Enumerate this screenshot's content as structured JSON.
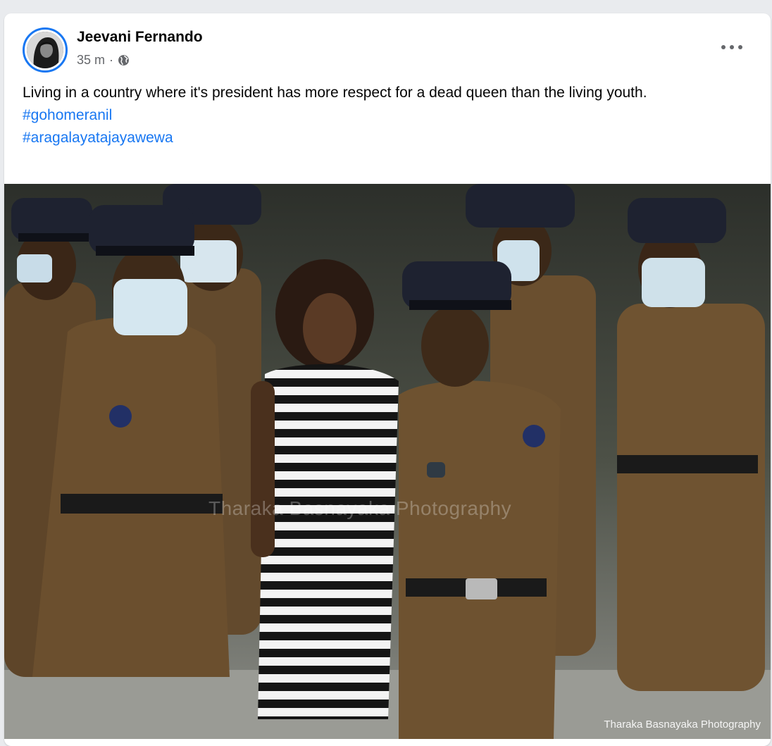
{
  "post": {
    "author": "Jeevani Fernando",
    "time": "35 m",
    "separator": "·",
    "visibility_icon": "globe-icon",
    "more_icon": "more-options-icon",
    "text": "Living in a country where it's president has more respect for a dead queen than the living youth.",
    "hashtags": [
      "#gohomeranil",
      "#aragalayatajayawewa"
    ]
  },
  "photo": {
    "watermark_center": "Tharaka Basnayaka Photography",
    "watermark_corner": "Tharaka Basnayaka Photography"
  },
  "colors": {
    "link": "#1877f2",
    "meta": "#65676b",
    "uniform": "#6b4f2e",
    "cap": "#1e2230"
  }
}
